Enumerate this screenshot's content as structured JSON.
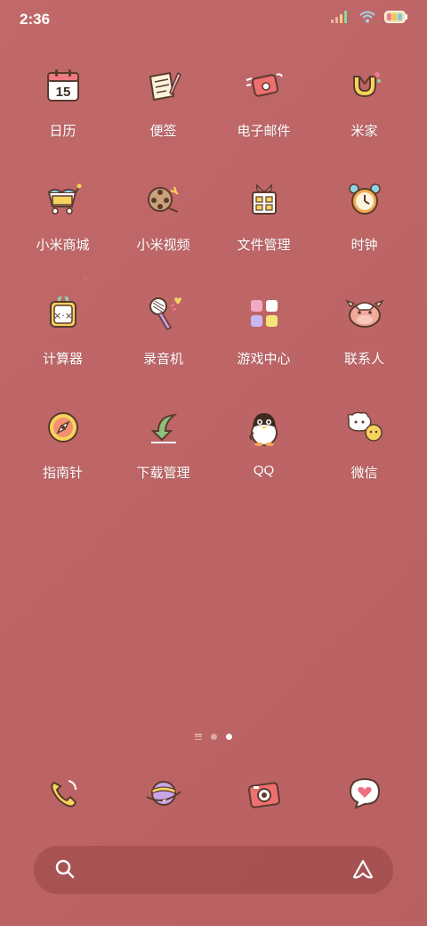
{
  "status": {
    "time": "2:36"
  },
  "apps": [
    {
      "label": "日历",
      "icon": "calendar-icon",
      "calendar_day": "15"
    },
    {
      "label": "便签",
      "icon": "notes-icon"
    },
    {
      "label": "电子邮件",
      "icon": "email-icon"
    },
    {
      "label": "米家",
      "icon": "mijia-icon"
    },
    {
      "label": "小米商城",
      "icon": "mi-store-icon"
    },
    {
      "label": "小米视频",
      "icon": "mi-video-icon"
    },
    {
      "label": "文件管理",
      "icon": "file-manager-icon"
    },
    {
      "label": "时钟",
      "icon": "clock-icon"
    },
    {
      "label": "计算器",
      "icon": "calculator-icon"
    },
    {
      "label": "录音机",
      "icon": "recorder-icon"
    },
    {
      "label": "游戏中心",
      "icon": "game-center-icon"
    },
    {
      "label": "联系人",
      "icon": "contacts-icon"
    },
    {
      "label": "指南针",
      "icon": "compass-icon"
    },
    {
      "label": "下载管理",
      "icon": "download-manager-icon"
    },
    {
      "label": "QQ",
      "icon": "qq-icon"
    },
    {
      "label": "微信",
      "icon": "wechat-icon"
    }
  ],
  "dock": [
    {
      "icon": "phone-icon"
    },
    {
      "icon": "browser-planet-icon"
    },
    {
      "icon": "camera-icon"
    },
    {
      "icon": "messages-icon"
    }
  ],
  "page_indicator": {
    "pages": 2,
    "current": 2
  },
  "colors": {
    "background": "#bf6465",
    "accent_yellow": "#f5cf5a",
    "label": "#ffffff"
  }
}
